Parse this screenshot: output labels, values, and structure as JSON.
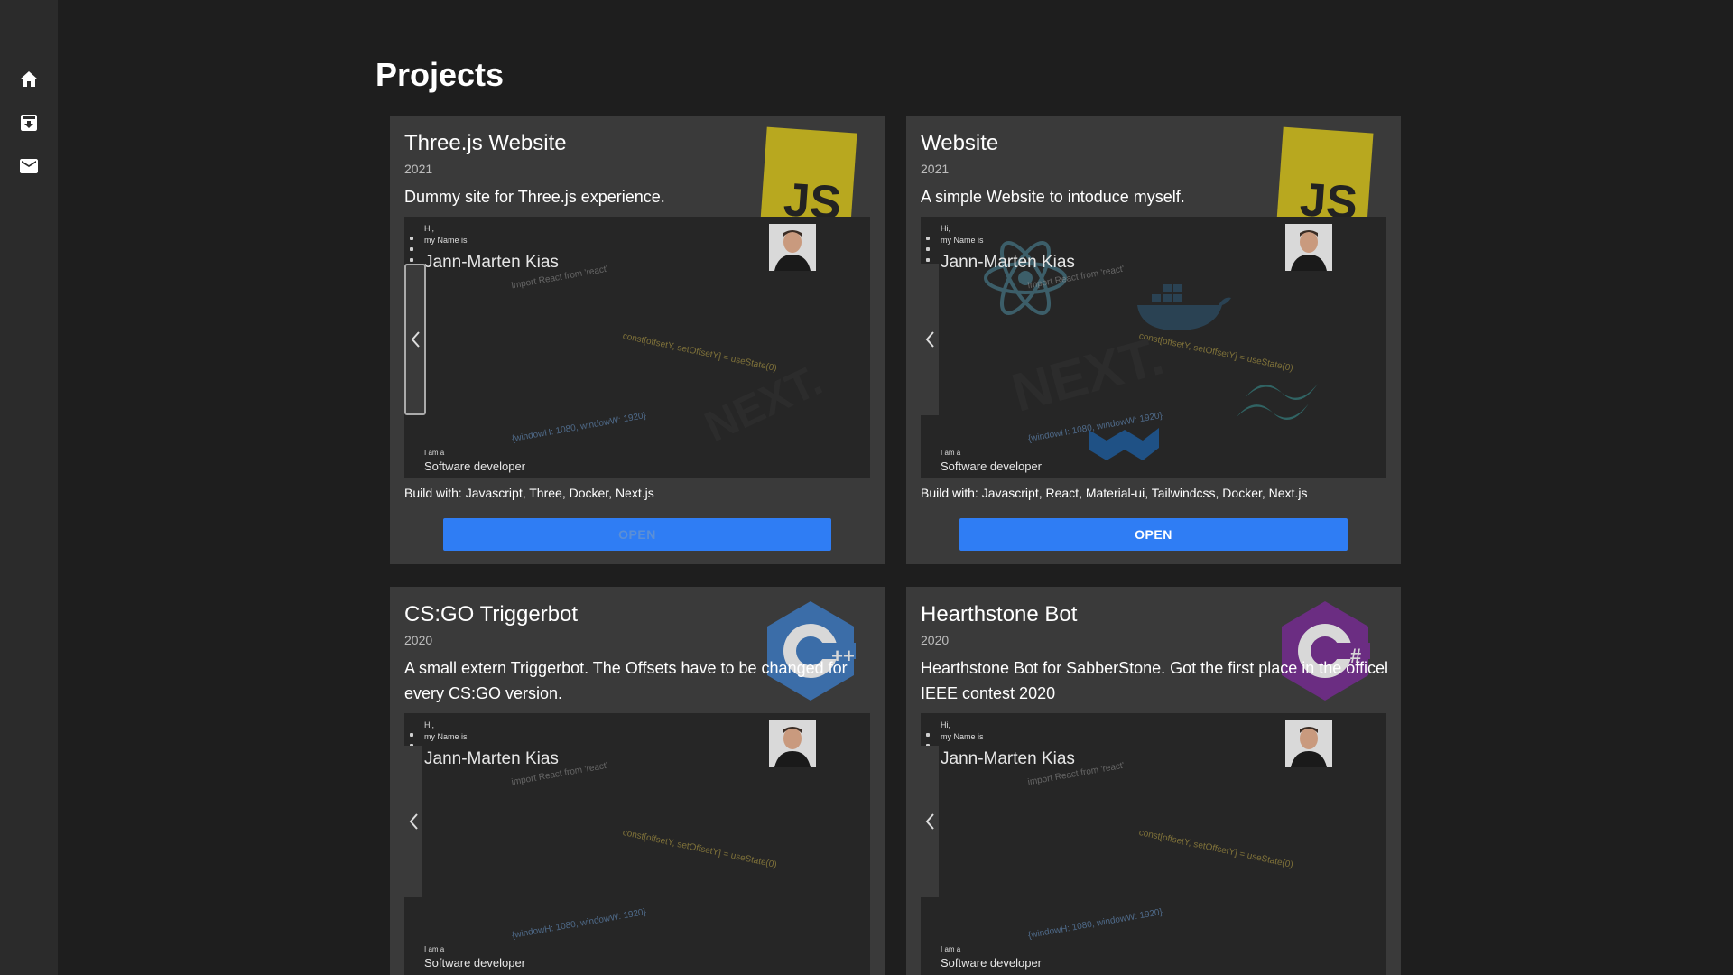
{
  "page": {
    "title": "Projects"
  },
  "sidebar": {
    "items": [
      {
        "icon": "home-icon"
      },
      {
        "icon": "archive-icon"
      },
      {
        "icon": "mail-icon"
      }
    ]
  },
  "preview": {
    "hi": "Hi,",
    "my_name_is": "my Name is",
    "name": "Jann-Marten Kias",
    "i_am": "I am a",
    "role": "Software developer",
    "code_import": "import React from 'react'",
    "code_state": "const[offsetY, setOffsetY] = useState(0)",
    "code_window": "{windowH: 1080, windowW: 1920}",
    "next_text": "NEXT."
  },
  "cards": [
    {
      "title": "Three.js Website",
      "year": "2021",
      "description": "Dummy site for Three.js experience.",
      "build_with": "Build with: Javascript, Three, Docker, Next.js",
      "button": "OPEN",
      "logo": "js-logo-icon",
      "logo_text": "JS"
    },
    {
      "title": "Website",
      "year": "2021",
      "description": "A simple Website to intoduce myself.",
      "build_with": "Build with: Javascript, React, Material-ui, Tailwindcss, Docker, Next.js",
      "button": "OPEN",
      "logo": "js-logo-icon",
      "logo_text": "JS"
    },
    {
      "title": "CS:GO Triggerbot",
      "year": "2020",
      "description": "A small extern Triggerbot. The Offsets have to be changed for every CS:GO version.",
      "logo": "cpp-logo-icon",
      "logo_text": "++"
    },
    {
      "title": "Hearthstone Bot",
      "year": "2020",
      "description": "Hearthstone Bot for SabberStone. Got the first place in the officel IEEE contest 2020",
      "logo": "csharp-logo-icon",
      "logo_text": "#"
    }
  ],
  "colors": {
    "background": "#1e1e1e",
    "sidebar": "#2b2b2b",
    "card": "#3a3a3a",
    "button": "#2f7df4",
    "js_yellow": "#b8a81f",
    "cpp_blue": "#3b6da8",
    "csharp_purple": "#6b2d82"
  }
}
